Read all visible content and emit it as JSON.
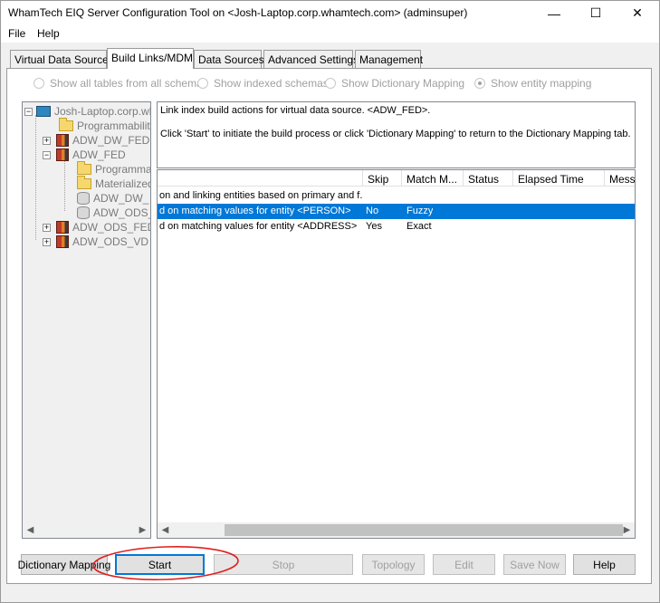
{
  "window": {
    "title": "WhamTech EIQ Server Configuration Tool on <Josh-Laptop.corp.whamtech.com> (adminsuper)",
    "minimize": "—",
    "maximize": "☐",
    "close": "✕"
  },
  "menu": {
    "file": "File",
    "help": "Help"
  },
  "tabs": [
    {
      "label": "Virtual Data Sources"
    },
    {
      "label": "Build Links/MDM"
    },
    {
      "label": "Data Sources"
    },
    {
      "label": "Advanced Settings"
    },
    {
      "label": "Management"
    }
  ],
  "active_tab": "Build Links/MDM",
  "radios": [
    {
      "label": "Show all tables from all schemas",
      "checked": false
    },
    {
      "label": "Show indexed schemas",
      "checked": false
    },
    {
      "label": "Show Dictionary Mapping",
      "checked": false
    },
    {
      "label": "Show entity mapping",
      "checked": true
    }
  ],
  "tree": {
    "root": "Josh-Laptop.corp.wh",
    "n_programmability": "Programmability",
    "n_adw_dw_fed": "ADW_DW_FED",
    "n_adw_fed": "ADW_FED",
    "n_programmab": "Programmab",
    "n_materialized": "Materialized",
    "n_adw_dw": "ADW_DW_",
    "n_adw_ods": "ADW_ODS_",
    "n_adw_ods_fed": "ADW_ODS_FED",
    "n_adw_ods_vd": "ADW_ODS_VD"
  },
  "message": {
    "line1": "Link index build actions for virtual data source. <ADW_FED>.",
    "line2": "Click 'Start' to initiate the build process or click 'Dictionary Mapping' to return to the Dictionary Mapping tab."
  },
  "grid": {
    "headers": {
      "skip": "Skip",
      "match": "Match M...",
      "status": "Status",
      "elapsed": "Elapsed Time",
      "message": "Messa"
    },
    "rows": [
      {
        "desc": "on and linking entities based on primary and f...",
        "skip": "",
        "match": "",
        "selected": false
      },
      {
        "desc": "d on matching values for entity <PERSON>",
        "skip": "No",
        "match": "Fuzzy",
        "selected": true
      },
      {
        "desc": "d on matching values for entity <ADDRESS>",
        "skip": "Yes",
        "match": "Exact",
        "selected": false
      }
    ]
  },
  "buttons": {
    "dictionary_mapping": "Dictionary Mapping",
    "start": "Start",
    "stop": "Stop",
    "topology": "Topology",
    "edit": "Edit",
    "save_now": "Save Now",
    "help": "Help"
  },
  "colors": {
    "selection": "#0078d7",
    "annotation": "#e02020"
  }
}
